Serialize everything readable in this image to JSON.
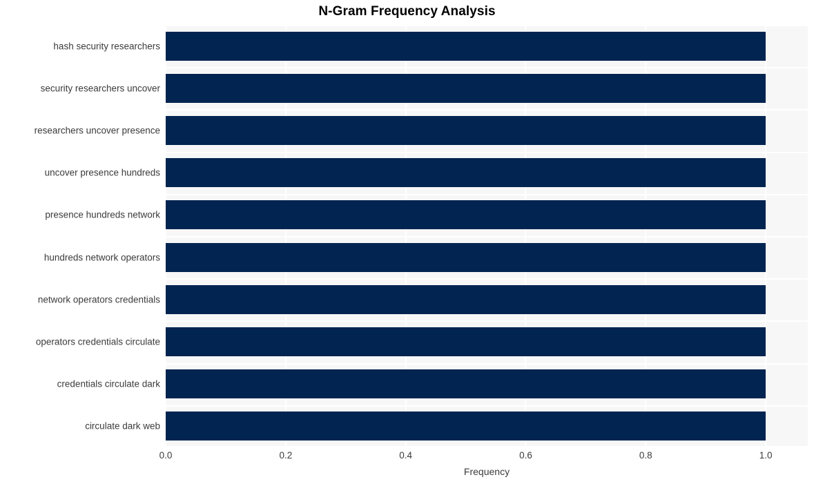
{
  "chart_data": {
    "type": "bar",
    "orientation": "horizontal",
    "title": "N-Gram Frequency Analysis",
    "xlabel": "Frequency",
    "ylabel": "",
    "categories": [
      "hash security researchers",
      "security researchers uncover",
      "researchers uncover presence",
      "uncover presence hundreds",
      "presence hundreds network",
      "hundreds network operators",
      "network operators credentials",
      "operators credentials circulate",
      "credentials circulate dark",
      "circulate dark web"
    ],
    "values": [
      1.0,
      1.0,
      1.0,
      1.0,
      1.0,
      1.0,
      1.0,
      1.0,
      1.0,
      1.0
    ],
    "xlim": [
      0.0,
      1.07
    ],
    "xticks": [
      "0.0",
      "0.2",
      "0.4",
      "0.6",
      "0.8",
      "1.0"
    ],
    "xtick_values": [
      0.0,
      0.2,
      0.4,
      0.6,
      0.8,
      1.0
    ],
    "grid": true,
    "legend": false,
    "bar_color": "#012450",
    "plot_background": "#f7f7f7",
    "grid_color": "#ffffff",
    "text_color": "#3b3b3b",
    "title_color": "#000000"
  }
}
